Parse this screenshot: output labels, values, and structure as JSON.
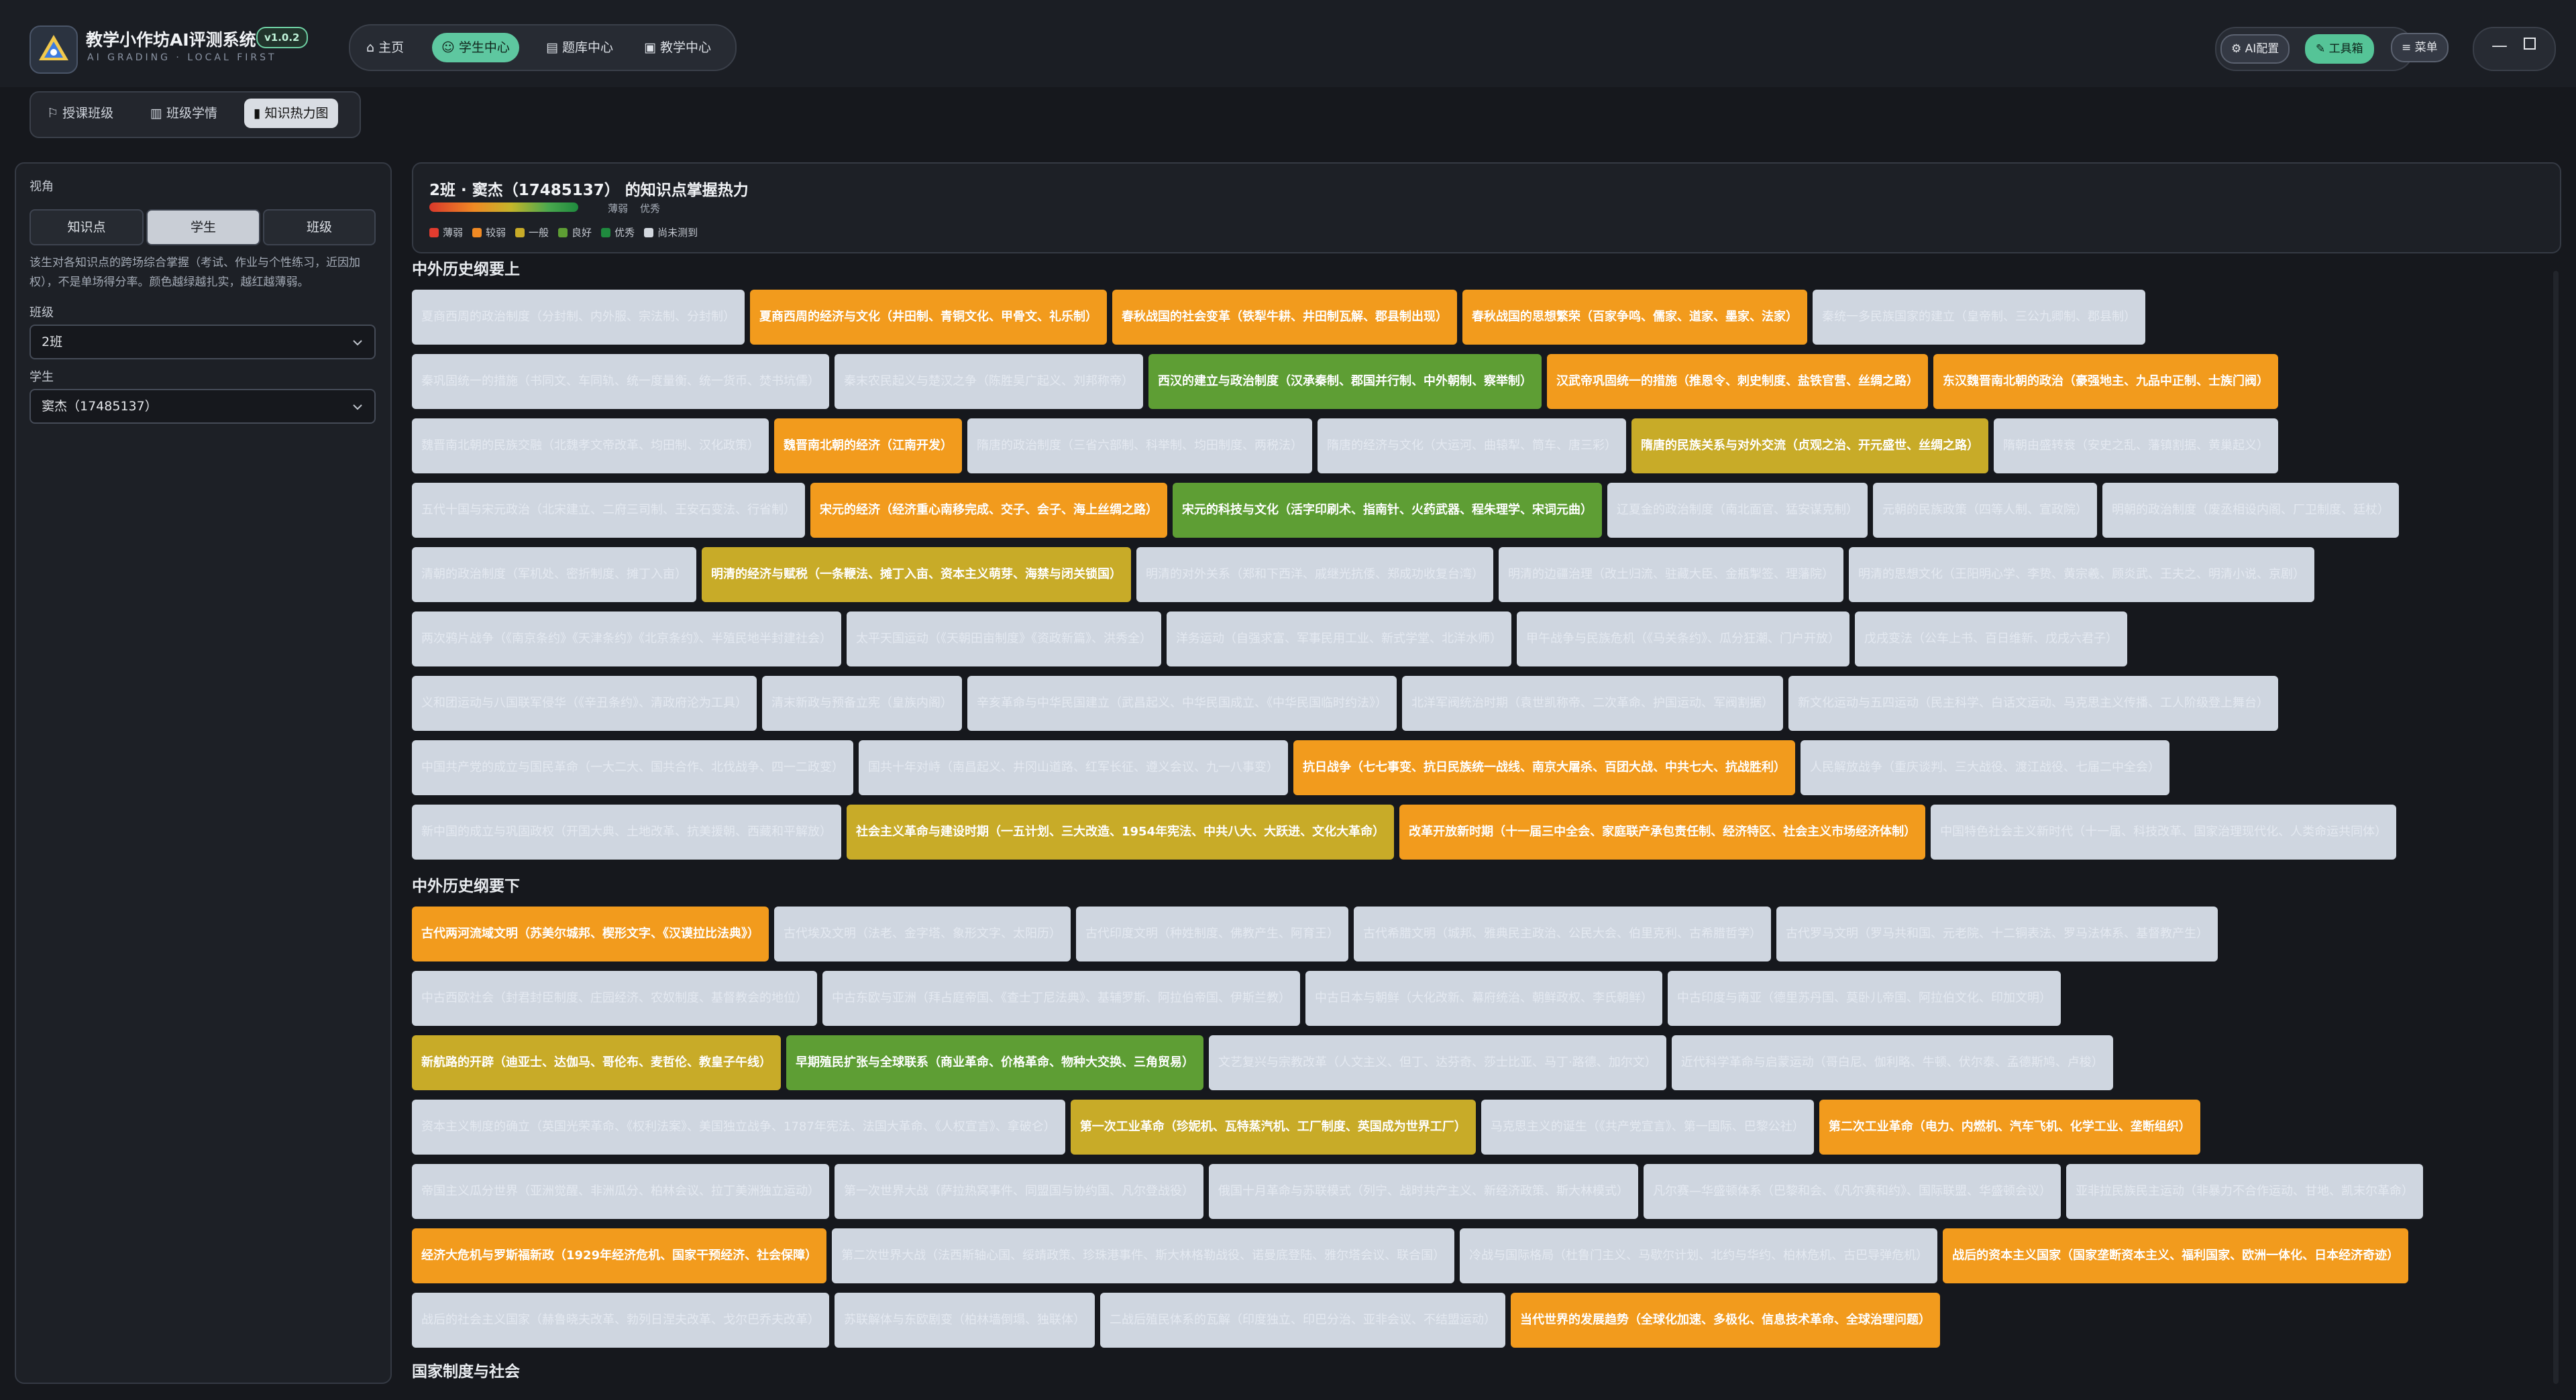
{
  "app": {
    "title": "教学小作坊AI评测系统",
    "version": "v1.0.2",
    "subtitle": "AI GRADING · LOCAL FIRST"
  },
  "nav": [
    {
      "label": "主页",
      "icon": "home-icon",
      "active": false
    },
    {
      "label": "学生中心",
      "icon": "user-icon",
      "active": true
    },
    {
      "label": "题库中心",
      "icon": "book-icon",
      "active": false
    },
    {
      "label": "教学中心",
      "icon": "clipboard-icon",
      "active": false
    }
  ],
  "toolbar": {
    "ai_config": "AI配置",
    "toolbox": "工具箱",
    "menu": "菜单"
  },
  "subnav": [
    {
      "label": "授课班级",
      "icon": "class-icon",
      "active": false
    },
    {
      "label": "班级学情",
      "icon": "chart-icon",
      "active": false
    },
    {
      "label": "知识热力图",
      "icon": "doc-icon",
      "active": true
    }
  ],
  "sidebar": {
    "view_label": "视角",
    "segments": [
      "知识点",
      "学生",
      "班级"
    ],
    "active_segment": "学生",
    "description": "该生对各知识点的跨场综合掌握（考试、作业与个性练习，近因加权），不是单场得分率。颜色越绿越扎实，越红越薄弱。",
    "class_label": "班级",
    "class_value": "2班",
    "student_label": "学生",
    "student_value": "窦杰（17485137）"
  },
  "header": {
    "title": "2班 · 窦杰（17485137） 的知识点掌握热力",
    "grad_low": "薄弱",
    "grad_high": "优秀",
    "legend": [
      {
        "label": "薄弱",
        "color": "#e23c2f"
      },
      {
        "label": "较弱",
        "color": "#f08a24"
      },
      {
        "label": "一般",
        "color": "#c8ab28"
      },
      {
        "label": "良好",
        "color": "#5e9e34"
      },
      {
        "label": "优秀",
        "color": "#1f8a3e"
      },
      {
        "label": "尚未测到",
        "color": "#d3d8df"
      }
    ]
  },
  "sections": [
    {
      "title": "中外历史纲要上",
      "rows": [
        [
          {
            "text": "夏商西周的政治制度（分封制、内外服、宗法制、分封制）",
            "level": "none"
          },
          {
            "text": "夏商西周的经济与文化（井田制、青铜文化、甲骨文、礼乐制）",
            "level": "ok"
          },
          {
            "text": "春秋战国的社会变革（铁犁牛耕、井田制瓦解、郡县制出现）",
            "level": "ok"
          },
          {
            "text": "春秋战国的思想繁荣（百家争鸣、儒家、道家、墨家、法家）",
            "level": "ok"
          },
          {
            "text": "秦统一多民族国家的建立（皇帝制、三公九卿制、郡县制）",
            "level": "none"
          }
        ],
        [
          {
            "text": "秦巩固统一的措施（书同文、车同轨、统一度量衡、统一货币、焚书坑儒）",
            "level": "none"
          },
          {
            "text": "秦末农民起义与楚汉之争（陈胜吴广起义、刘邦称帝）",
            "level": "none"
          },
          {
            "text": "西汉的建立与政治制度（汉承秦制、郡国并行制、中外朝制、察举制）",
            "level": "good"
          },
          {
            "text": "汉武帝巩固统一的措施（推恩令、刺史制度、盐铁官营、丝绸之路）",
            "level": "ok"
          },
          {
            "text": "东汉魏晋南北朝的政治（豪强地主、九品中正制、士族门阀）",
            "level": "ok"
          }
        ],
        [
          {
            "text": "魏晋南北朝的民族交融（北魏孝文帝改革、均田制、汉化政策）",
            "level": "none"
          },
          {
            "text": "魏晋南北朝的经济（江南开发）",
            "level": "ok"
          },
          {
            "text": "隋唐的政治制度（三省六部制、科举制、均田制度、两税法）",
            "level": "none"
          },
          {
            "text": "隋唐的经济与文化（大运河、曲辕犁、筒车、唐三彩）",
            "level": "none"
          },
          {
            "text": "隋唐的民族关系与对外交流（贞观之治、开元盛世、丝绸之路）",
            "level": "mid"
          },
          {
            "text": "隋朝由盛转衰（安史之乱、藩镇割据、黄巢起义）",
            "level": "none"
          }
        ],
        [
          {
            "text": "五代十国与宋元政治（北宋建立、二府三司制、王安石变法、行省制）",
            "level": "none"
          },
          {
            "text": "宋元的经济（经济重心南移完成、交子、会子、海上丝绸之路）",
            "level": "ok"
          },
          {
            "text": "宋元的科技与文化（活字印刷术、指南针、火药武器、程朱理学、宋词元曲）",
            "level": "good"
          },
          {
            "text": "辽夏金的政治制度（南北面官、猛安谋克制）",
            "level": "none"
          },
          {
            "text": "元朝的民族政策（四等人制、宣政院）",
            "level": "none"
          },
          {
            "text": "明朝的政治制度（废丞相设内阁、厂卫制度、廷杖）",
            "level": "none"
          }
        ],
        [
          {
            "text": "清朝的政治制度（军机处、密折制度、摊丁入亩）",
            "level": "none"
          },
          {
            "text": "明清的经济与赋税（一条鞭法、摊丁入亩、资本主义萌芽、海禁与闭关锁国）",
            "level": "mid"
          },
          {
            "text": "明清的对外关系（郑和下西洋、戚继光抗倭、郑成功收复台湾）",
            "level": "none"
          },
          {
            "text": "明清的边疆治理（改土归流、驻藏大臣、金瓶掣签、理藩院）",
            "level": "none"
          },
          {
            "text": "明清的思想文化（王阳明心学、李贽、黄宗羲、顾炎武、王夫之、明清小说、京剧）",
            "level": "none"
          }
        ],
        [
          {
            "text": "两次鸦片战争（《南京条约》《天津条约》《北京条约》、半殖民地半封建社会）",
            "level": "none"
          },
          {
            "text": "太平天国运动（《天朝田亩制度》《资政新篇》、洪秀全）",
            "level": "none"
          },
          {
            "text": "洋务运动（自强求富、军事民用工业、新式学堂、北洋水师）",
            "level": "none"
          },
          {
            "text": "甲午战争与民族危机（《马关条约》、瓜分狂潮、门户开放）",
            "level": "none"
          },
          {
            "text": "戊戌变法（公车上书、百日维新、戊戌六君子）",
            "level": "none"
          }
        ],
        [
          {
            "text": "义和团运动与八国联军侵华（《辛丑条约》、清政府沦为工具）",
            "level": "none"
          },
          {
            "text": "清末新政与预备立宪（皇族内阁）",
            "level": "none"
          },
          {
            "text": "辛亥革命与中华民国建立（武昌起义、中华民国成立、《中华民国临时约法》）",
            "level": "none"
          },
          {
            "text": "北洋军阀统治时期（袁世凯称帝、二次革命、护国运动、军阀割据）",
            "level": "none"
          },
          {
            "text": "新文化运动与五四运动（民主科学、白话文运动、马克思主义传播、工人阶级登上舞台）",
            "level": "none"
          }
        ],
        [
          {
            "text": "中国共产党的成立与国民革命（一大二大、国共合作、北伐战争、四一二政变）",
            "level": "none"
          },
          {
            "text": "国共十年对峙（南昌起义、井冈山道路、红军长征、遵义会议、九一八事变）",
            "level": "none"
          },
          {
            "text": "抗日战争（七七事变、抗日民族统一战线、南京大屠杀、百团大战、中共七大、抗战胜利）",
            "level": "ok"
          },
          {
            "text": "人民解放战争（重庆谈判、三大战役、渡江战役、七届二中全会）",
            "level": "none"
          }
        ],
        [
          {
            "text": "新中国的成立与巩固政权（开国大典、土地改革、抗美援朝、西藏和平解放）",
            "level": "none"
          },
          {
            "text": "社会主义革命与建设时期（一五计划、三大改造、1954年宪法、中共八大、大跃进、文化大革命）",
            "level": "mid"
          },
          {
            "text": "改革开放新时期（十一届三中全会、家庭联产承包责任制、经济特区、社会主义市场经济体制）",
            "level": "ok"
          },
          {
            "text": "中国特色社会主义新时代（十一届、科技改革、国家治理现代化、人类命运共同体）",
            "level": "none"
          }
        ]
      ]
    },
    {
      "title": "中外历史纲要下",
      "rows": [
        [
          {
            "text": "古代两河流域文明（苏美尔城邦、楔形文字、《汉谟拉比法典》）",
            "level": "ok"
          },
          {
            "text": "古代埃及文明（法老、金字塔、象形文字、太阳历）",
            "level": "none"
          },
          {
            "text": "古代印度文明（种姓制度、佛教产生、阿育王）",
            "level": "none"
          },
          {
            "text": "古代希腊文明（城邦、雅典民主政治、公民大会、伯里克利、古希腊哲学）",
            "level": "none"
          },
          {
            "text": "古代罗马文明（罗马共和国、元老院、十二铜表法、罗马法体系、基督教产生）",
            "level": "none"
          }
        ],
        [
          {
            "text": "中古西欧社会（封君封臣制度、庄园经济、农奴制度、基督教会的地位）",
            "level": "none"
          },
          {
            "text": "中古东欧与亚洲（拜占庭帝国、《查士丁尼法典》、基辅罗斯、阿拉伯帝国、伊斯兰教）",
            "level": "none"
          },
          {
            "text": "中古日本与朝鲜（大化改新、幕府统治、朝鲜政权、李氏朝鲜）",
            "level": "none"
          },
          {
            "text": "中古印度与南亚（德里苏丹国、莫卧儿帝国、阿拉伯文化、印加文明）",
            "level": "none"
          }
        ],
        [
          {
            "text": "新航路的开辟（迪亚士、达伽马、哥伦布、麦哲伦、教皇子午线）",
            "level": "mid"
          },
          {
            "text": "早期殖民扩张与全球联系（商业革命、价格革命、物种大交换、三角贸易）",
            "level": "good"
          },
          {
            "text": "文艺复兴与宗教改革（人文主义、但丁、达芬奇、莎士比亚、马丁·路德、加尔文）",
            "level": "none"
          },
          {
            "text": "近代科学革命与启蒙运动（哥白尼、伽利略、牛顿、伏尔泰、孟德斯鸠、卢梭）",
            "level": "none"
          }
        ],
        [
          {
            "text": "资本主义制度的确立（英国光荣革命、《权利法案》、美国独立战争、1787年宪法、法国大革命、《人权宣言》、拿破仑）",
            "level": "none"
          },
          {
            "text": "第一次工业革命（珍妮机、瓦特蒸汽机、工厂制度、英国成为世界工厂）",
            "level": "mid"
          },
          {
            "text": "马克思主义的诞生（《共产党宣言》、第一国际、巴黎公社）",
            "level": "none"
          },
          {
            "text": "第二次工业革命（电力、内燃机、汽车飞机、化学工业、垄断组织）",
            "level": "ok"
          }
        ],
        [
          {
            "text": "帝国主义瓜分世界（亚洲觉醒、非洲瓜分、柏林会议、拉丁美洲独立运动）",
            "level": "none"
          },
          {
            "text": "第一次世界大战（萨拉热窝事件、同盟国与协约国、凡尔登战役）",
            "level": "none"
          },
          {
            "text": "俄国十月革命与苏联模式（列宁、战时共产主义、新经济政策、斯大林模式）",
            "level": "none"
          },
          {
            "text": "凡尔赛—华盛顿体系（巴黎和会、《凡尔赛和约》、国际联盟、华盛顿会议）",
            "level": "none"
          },
          {
            "text": "亚非拉民族民主运动（非暴力不合作运动、甘地、凯末尔革命）",
            "level": "none"
          }
        ],
        [
          {
            "text": "经济大危机与罗斯福新政（1929年经济危机、国家干预经济、社会保障）",
            "level": "ok"
          },
          {
            "text": "第二次世界大战（法西斯轴心国、绥靖政策、珍珠港事件、斯大林格勒战役、诺曼底登陆、雅尔塔会议、联合国）",
            "level": "none"
          },
          {
            "text": "冷战与国际格局（杜鲁门主义、马歇尔计划、北约与华约、柏林危机、古巴导弹危机）",
            "level": "none"
          },
          {
            "text": "战后的资本主义国家（国家垄断资本主义、福利国家、欧洲一体化、日本经济奇迹）",
            "level": "ok"
          }
        ],
        [
          {
            "text": "战后的社会主义国家（赫鲁晓夫改革、勃列日涅夫改革、戈尔巴乔夫改革）",
            "level": "none"
          },
          {
            "text": "苏联解体与东欧剧变（柏林墙倒塌、独联体）",
            "level": "none"
          },
          {
            "text": "二战后殖民体系的瓦解（印度独立、印巴分治、亚非会议、不结盟运动）",
            "level": "none"
          },
          {
            "text": "当代世界的发展趋势（全球化加速、多极化、信息技术革命、全球治理问题）",
            "level": "ok"
          }
        ]
      ]
    },
    {
      "title": "国家制度与社会",
      "rows": []
    }
  ]
}
